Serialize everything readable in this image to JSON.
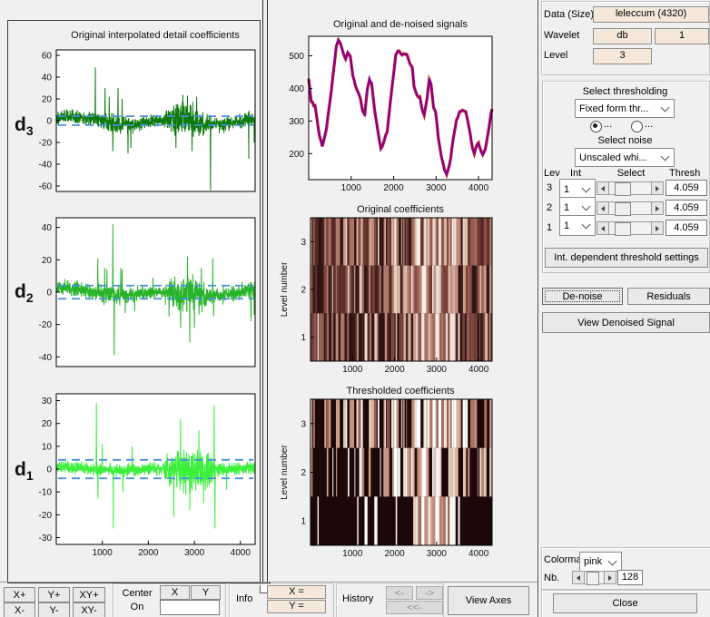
{
  "right_panel": {
    "data_label": "Data  (Size)",
    "data_value": "leleccum  (4320)",
    "wavelet_label": "Wavelet",
    "wavelet_family": "db",
    "wavelet_number": "1",
    "level_label": "Level",
    "level_value": "3",
    "thresholding": {
      "title": "Select thresholding",
      "method_value": "Fixed form thr...",
      "radio1_label": "...",
      "radio2_label": "...",
      "noise_title": "Select noise",
      "noise_value": "Unscaled whi...",
      "table": {
        "headers": [
          "Lev",
          "Int",
          "Select",
          "Thresh"
        ],
        "rows": [
          {
            "lev": "3",
            "int": "1",
            "thresh": "4.059"
          },
          {
            "lev": "2",
            "int": "1",
            "thresh": "4.059"
          },
          {
            "lev": "1",
            "int": "1",
            "thresh": "4.059"
          }
        ]
      },
      "int_button": "Int. dependent threshold settings"
    },
    "denoise_button": "De-noise",
    "residuals_button": "Residuals",
    "view_denoised_button": "View Denoised Signal",
    "colormap_label": "Colorma",
    "colormap_value": "pink",
    "nb_label": "Nb.",
    "nb_value": "128",
    "close_button": "Close"
  },
  "toolbar": {
    "zoom_buttons": [
      "X+",
      "Y+",
      "XY+",
      "X-",
      "Y-",
      "XY-"
    ],
    "center_label": "Center",
    "on_label": "On",
    "center_x": "X",
    "center_y": "Y",
    "info_label": "Info",
    "info_x": "X =",
    "info_y": "Y =",
    "history_label": "History",
    "history_back": "<-",
    "history_fwd": "->",
    "history_all": "<<-",
    "view_axes": "View Axes"
  },
  "chart_data": [
    {
      "id": "d3",
      "type": "line-noise",
      "group_title": "Original interpolated detail coefficients",
      "label": "d",
      "sub": "3",
      "ylim": [
        -65,
        65
      ],
      "yticks": [
        60,
        40,
        20,
        0,
        -20,
        -40,
        -60
      ],
      "xlim": [
        0,
        4320
      ],
      "threshold": 4.059,
      "threshold_color": "#4a90d9",
      "color": "#0c7a0c",
      "seed": 101,
      "drift": 3,
      "envelope": [
        [
          0,
          6
        ],
        [
          800,
          6
        ],
        [
          900,
          7
        ],
        [
          1500,
          8
        ],
        [
          1800,
          6
        ],
        [
          2300,
          5
        ],
        [
          2450,
          9
        ],
        [
          2600,
          13
        ],
        [
          2900,
          14
        ],
        [
          3100,
          12
        ],
        [
          3250,
          8
        ],
        [
          3400,
          6
        ],
        [
          4320,
          6
        ]
      ],
      "spikes": [
        [
          850,
          49
        ],
        [
          1060,
          30
        ],
        [
          1150,
          22
        ],
        [
          1230,
          -28
        ],
        [
          1340,
          30
        ],
        [
          1430,
          20
        ],
        [
          1560,
          -30
        ],
        [
          1620,
          -25
        ],
        [
          2600,
          -25
        ],
        [
          2750,
          24
        ],
        [
          2850,
          23
        ],
        [
          2950,
          -28
        ],
        [
          3050,
          22
        ],
        [
          3350,
          -64
        ],
        [
          4180,
          -35
        ],
        [
          4300,
          -20
        ]
      ]
    },
    {
      "id": "d2",
      "type": "line-noise",
      "label": "d",
      "sub": "2",
      "ylim": [
        -46,
        46
      ],
      "yticks": [
        40,
        20,
        0,
        -20,
        -40
      ],
      "xlim": [
        0,
        4320
      ],
      "threshold": 4.059,
      "threshold_color": "#4a90d9",
      "color": "#28b428",
      "seed": 202,
      "drift": 1.6,
      "envelope": [
        [
          0,
          4
        ],
        [
          800,
          4.5
        ],
        [
          1000,
          5
        ],
        [
          1400,
          5
        ],
        [
          1600,
          4
        ],
        [
          2300,
          3.5
        ],
        [
          2400,
          7
        ],
        [
          2600,
          10
        ],
        [
          2900,
          11
        ],
        [
          3100,
          9
        ],
        [
          3250,
          6
        ],
        [
          3400,
          4.5
        ],
        [
          4320,
          4.5
        ]
      ],
      "spikes": [
        [
          900,
          21
        ],
        [
          1050,
          15
        ],
        [
          1100,
          14
        ],
        [
          1230,
          42
        ],
        [
          1260,
          -39
        ],
        [
          1400,
          15
        ],
        [
          1430,
          14
        ],
        [
          1500,
          -13
        ],
        [
          1700,
          -12
        ],
        [
          2100,
          9
        ],
        [
          2450,
          -15
        ],
        [
          2700,
          -22
        ],
        [
          2850,
          22
        ],
        [
          2900,
          -31
        ],
        [
          3000,
          -22
        ],
        [
          3150,
          15
        ],
        [
          3400,
          21
        ],
        [
          3420,
          -15
        ],
        [
          4230,
          -18
        ],
        [
          4300,
          -14
        ]
      ]
    },
    {
      "id": "d1",
      "type": "line-noise",
      "label": "d",
      "sub": "1",
      "ylim": [
        -33,
        33
      ],
      "yticks": [
        30,
        20,
        10,
        0,
        -10,
        -20,
        -30
      ],
      "xlim": [
        0,
        4320
      ],
      "xticks": [
        1000,
        2000,
        3000,
        4000
      ],
      "threshold": 4.059,
      "threshold_color": "#4a90d9",
      "color": "#3bef3b",
      "seed": 303,
      "drift": 0.5,
      "envelope": [
        [
          0,
          2.2
        ],
        [
          700,
          2.2
        ],
        [
          900,
          3
        ],
        [
          1100,
          2.5
        ],
        [
          2300,
          2.3
        ],
        [
          2400,
          7
        ],
        [
          2600,
          9
        ],
        [
          3000,
          9
        ],
        [
          3300,
          8
        ],
        [
          3400,
          4
        ],
        [
          3500,
          2.5
        ],
        [
          4320,
          2.5
        ]
      ],
      "spikes": [
        [
          870,
          29
        ],
        [
          905,
          -13
        ],
        [
          1000,
          11
        ],
        [
          1240,
          -26
        ],
        [
          1450,
          -10
        ],
        [
          1650,
          10
        ],
        [
          2550,
          -21
        ],
        [
          2700,
          22
        ],
        [
          2900,
          -18
        ],
        [
          3100,
          17
        ],
        [
          3200,
          -15
        ],
        [
          3430,
          28
        ],
        [
          3450,
          -26
        ],
        [
          3700,
          -9
        ]
      ]
    },
    {
      "id": "signal",
      "type": "line",
      "title": "Original and de-noised signals",
      "ylim": [
        120,
        560
      ],
      "yticks": [
        500,
        400,
        300,
        200
      ],
      "xlim": [
        0,
        4320
      ],
      "xticks": [
        1000,
        2000,
        3000,
        4000
      ],
      "original_color": "#d42a00",
      "denoised_color": "#8b008b",
      "seed": 77,
      "points": [
        [
          0,
          430
        ],
        [
          60,
          360
        ],
        [
          150,
          345
        ],
        [
          250,
          260
        ],
        [
          320,
          222
        ],
        [
          420,
          280
        ],
        [
          520,
          380
        ],
        [
          600,
          470
        ],
        [
          650,
          530
        ],
        [
          700,
          548
        ],
        [
          760,
          535
        ],
        [
          820,
          505
        ],
        [
          870,
          490
        ],
        [
          920,
          510
        ],
        [
          980,
          498
        ],
        [
          1040,
          440
        ],
        [
          1100,
          410
        ],
        [
          1160,
          392
        ],
        [
          1220,
          370
        ],
        [
          1270,
          330
        ],
        [
          1320,
          318
        ],
        [
          1380,
          395
        ],
        [
          1430,
          430
        ],
        [
          1480,
          415
        ],
        [
          1560,
          330
        ],
        [
          1650,
          250
        ],
        [
          1700,
          215
        ],
        [
          1780,
          240
        ],
        [
          1850,
          270
        ],
        [
          1950,
          390
        ],
        [
          2050,
          500
        ],
        [
          2100,
          515
        ],
        [
          2200,
          505
        ],
        [
          2300,
          505
        ],
        [
          2380,
          478
        ],
        [
          2440,
          462
        ],
        [
          2480,
          405
        ],
        [
          2550,
          380
        ],
        [
          2620,
          372
        ],
        [
          2680,
          330
        ],
        [
          2720,
          318
        ],
        [
          2790,
          370
        ],
        [
          2840,
          430
        ],
        [
          2880,
          415
        ],
        [
          2940,
          340
        ],
        [
          2990,
          330
        ],
        [
          3050,
          255
        ],
        [
          3120,
          195
        ],
        [
          3200,
          150
        ],
        [
          3250,
          135
        ],
        [
          3320,
          165
        ],
        [
          3400,
          240
        ],
        [
          3480,
          300
        ],
        [
          3550,
          330
        ],
        [
          3620,
          332
        ],
        [
          3700,
          328
        ],
        [
          3780,
          280
        ],
        [
          3860,
          215
        ],
        [
          3900,
          200
        ],
        [
          3960,
          225
        ],
        [
          4000,
          232
        ],
        [
          4060,
          205
        ],
        [
          4100,
          196
        ],
        [
          4160,
          215
        ],
        [
          4230,
          265
        ],
        [
          4290,
          320
        ],
        [
          4320,
          337
        ]
      ]
    },
    {
      "id": "orig-coeffs",
      "type": "heatmap",
      "mode": "original",
      "title": "Original coefficients",
      "ylabel": "Level number",
      "yticks": [
        "3",
        "2",
        "1"
      ],
      "xlim": [
        0,
        4320
      ],
      "xticks": [
        1000,
        2000,
        3000,
        4000
      ],
      "colormap": "pink",
      "levels": [
        3,
        2,
        1
      ],
      "seed": 404,
      "cluster": [
        2420,
        3370
      ]
    },
    {
      "id": "thresh-coeffs",
      "type": "heatmap",
      "mode": "thresholded",
      "title": "Thresholded coefficients",
      "ylabel": "Level number",
      "yticks": [
        "3",
        "2",
        "1"
      ],
      "xlim": [
        0,
        4320
      ],
      "xticks": [
        1000,
        2000,
        3000,
        4000
      ],
      "colormap": "pink",
      "levels": [
        3,
        2,
        1
      ],
      "seed": 404,
      "cluster": [
        2420,
        3370
      ],
      "cutoffs": {
        "3": 0.32,
        "2": 0.48,
        "1": 0.85,
        "1_cluster": 0.2
      }
    }
  ]
}
